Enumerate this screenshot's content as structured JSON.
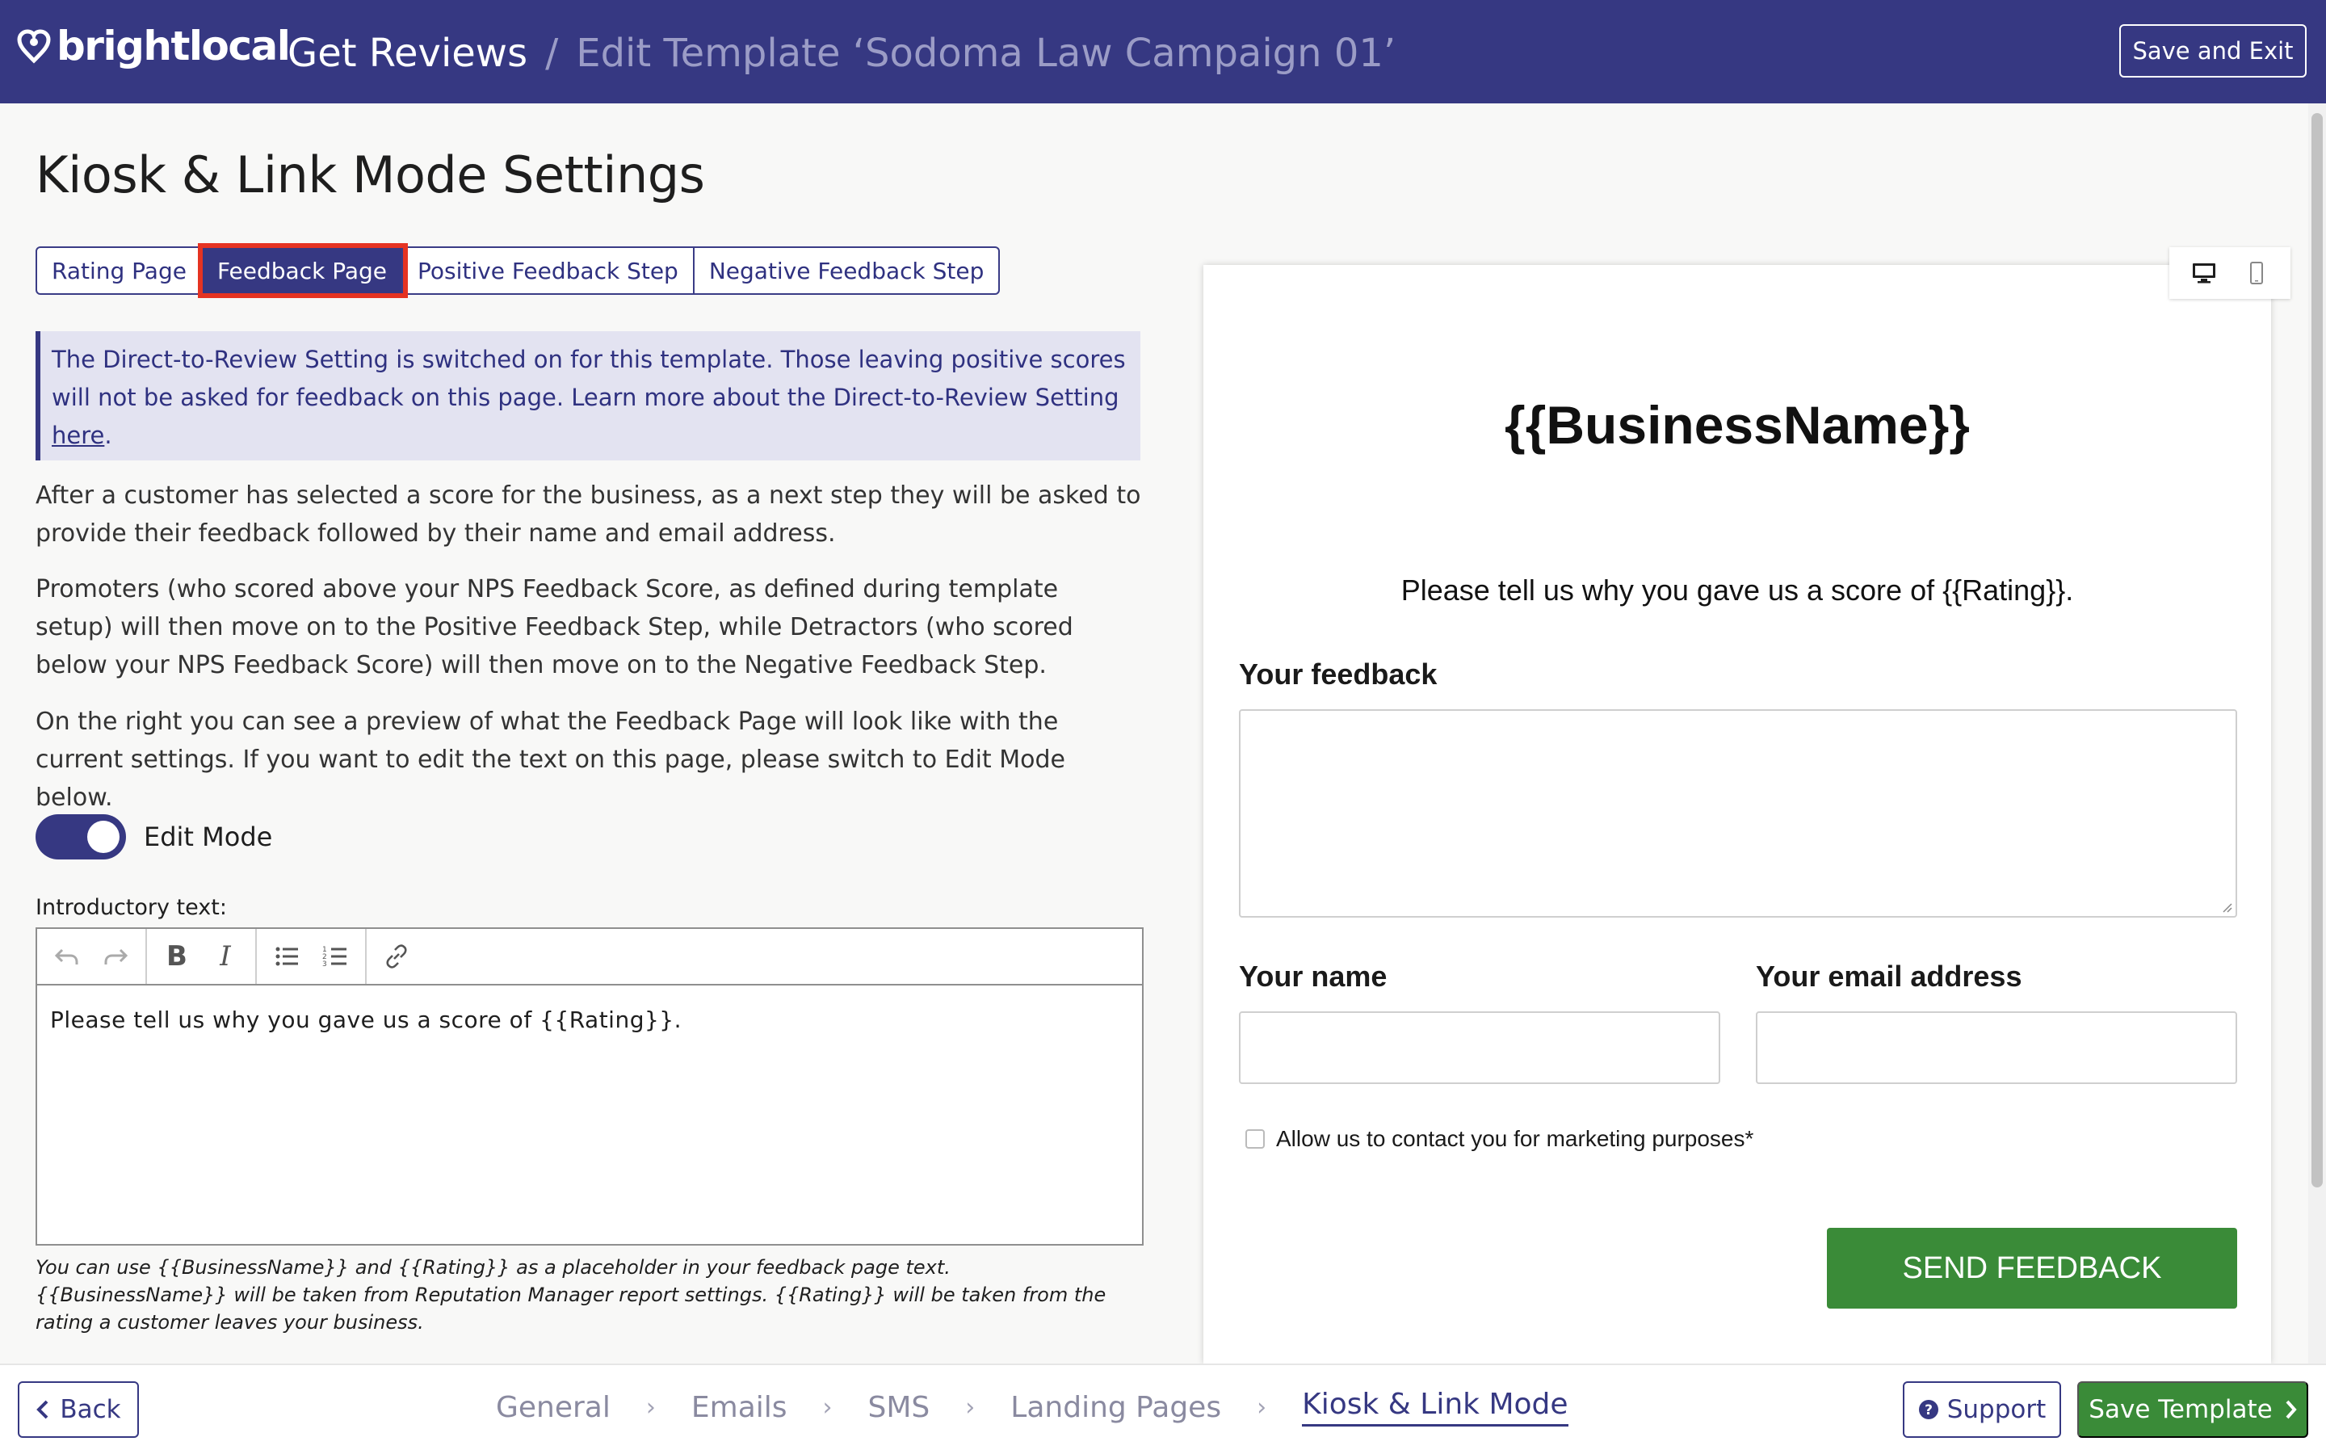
{
  "header": {
    "logo_text": "brightlocal",
    "breadcrumb_main": "Get Reviews",
    "breadcrumb_separator": "/",
    "breadcrumb_sub": "Edit Template ‘Sodoma Law Campaign 01’",
    "save_exit_label": "Save and Exit"
  },
  "page": {
    "title": "Kiosk & Link Mode Settings",
    "tabs": [
      {
        "label": "Rating Page",
        "active": false
      },
      {
        "label": "Feedback Page",
        "active": true
      },
      {
        "label": "Positive Feedback Step",
        "active": false
      },
      {
        "label": "Negative Feedback Step",
        "active": false
      }
    ],
    "info": {
      "text": "The Direct-to-Review Setting is switched on for this template. Those leaving positive scores will not be asked for feedback on this page. Learn more about the Direct-to-Review Setting ",
      "link": "here",
      "end": "."
    },
    "paragraphs": [
      "After a customer has selected a score for the business, as a next step they will be asked to provide their feedback followed by their name and email address.",
      "Promoters (who scored above your NPS Feedback Score, as defined during template setup) will then move on to the Positive Feedback Step, while Detractors (who scored below your NPS Feedback Score) will then move on to the Negative Feedback Step.",
      "On the right you can see a preview of what the Feedback Page will look like with the current settings. If you want to edit the text on this page, please switch to Edit Mode below."
    ],
    "edit_mode": {
      "label": "Edit Mode",
      "on": true
    },
    "intro_label": "Introductory text:",
    "editor_content": "Please tell us why you gave us a score of {{Rating}}.",
    "hint": "You can use {{BusinessName}} and {{Rating}} as a placeholder in your feedback page text. {{BusinessName}} will be taken from Reputation Manager report settings. {{Rating}} will be taken from the rating a customer leaves your business."
  },
  "preview": {
    "business_name": "{{BusinessName}}",
    "question": "Please tell us why you gave us a score of {{Rating}}.",
    "feedback_label": "Your feedback",
    "name_label": "Your name",
    "email_label": "Your email address",
    "marketing_label": "Allow us to contact you for marketing purposes*",
    "send_label": "SEND FEEDBACK"
  },
  "footer": {
    "back_label": "Back",
    "steps": [
      "General",
      "Emails",
      "SMS",
      "Landing Pages",
      "Kiosk & Link Mode"
    ],
    "active_step": "Kiosk & Link Mode",
    "support_label": "Support",
    "save_template_label": "Save Template"
  },
  "colors": {
    "brand": "#363882",
    "success": "#3a8b38",
    "highlight": "#e53322"
  }
}
